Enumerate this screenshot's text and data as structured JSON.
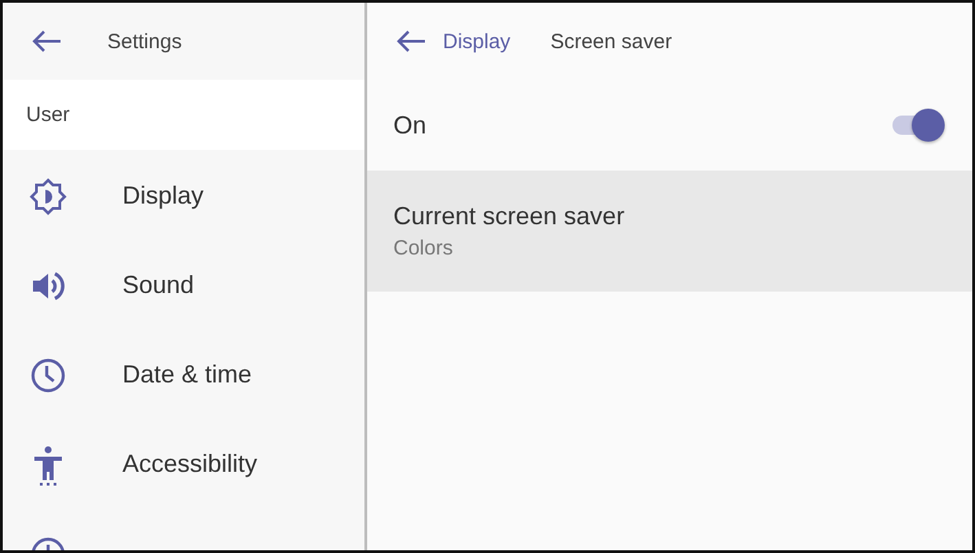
{
  "sidebar": {
    "title": "Settings",
    "section": "User",
    "items": [
      {
        "kind": "display",
        "label": "Display"
      },
      {
        "kind": "sound",
        "label": "Sound"
      },
      {
        "kind": "clock",
        "label": "Date & time"
      },
      {
        "kind": "accessibility",
        "label": "Accessibility"
      },
      {
        "kind": "power"
      }
    ]
  },
  "breadcrumb": {
    "parent": "Display",
    "current": "Screen saver"
  },
  "settings": [
    {
      "kind": "toggle",
      "label": "On",
      "on": true,
      "selected": false
    },
    {
      "kind": "detail",
      "label": "Current screen saver",
      "value": "Colors",
      "selected": true
    }
  ]
}
